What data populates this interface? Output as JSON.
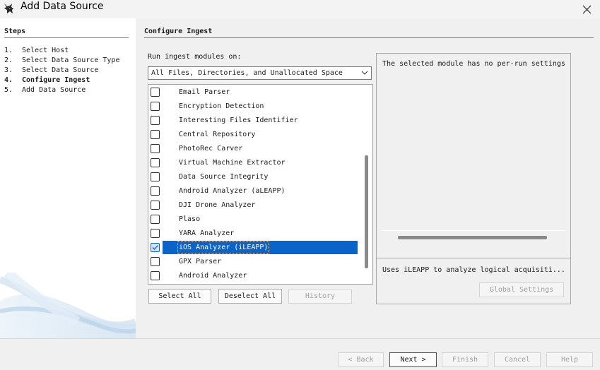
{
  "window": {
    "title": "Add Data Source"
  },
  "steps": {
    "title": "Steps",
    "items": [
      {
        "num": "1.",
        "label": "Select Host",
        "active": false
      },
      {
        "num": "2.",
        "label": "Select Data Source Type",
        "active": false
      },
      {
        "num": "3.",
        "label": "Select Data Source",
        "active": false
      },
      {
        "num": "4.",
        "label": "Configure Ingest",
        "active": true
      },
      {
        "num": "5.",
        "label": "Add Data Source",
        "active": false
      }
    ]
  },
  "configure": {
    "title": "Configure Ingest",
    "run_label": "Run ingest modules on:",
    "run_value": "All Files, Directories, and Unallocated Space",
    "modules": [
      {
        "label": "Email Parser",
        "checked": false,
        "selected": false
      },
      {
        "label": "Encryption Detection",
        "checked": false,
        "selected": false
      },
      {
        "label": "Interesting Files Identifier",
        "checked": false,
        "selected": false
      },
      {
        "label": "Central Repository",
        "checked": false,
        "selected": false
      },
      {
        "label": "PhotoRec Carver",
        "checked": false,
        "selected": false
      },
      {
        "label": "Virtual Machine Extractor",
        "checked": false,
        "selected": false
      },
      {
        "label": "Data Source Integrity",
        "checked": false,
        "selected": false
      },
      {
        "label": "Android Analyzer (aLEAPP)",
        "checked": false,
        "selected": false
      },
      {
        "label": "DJI Drone Analyzer",
        "checked": false,
        "selected": false
      },
      {
        "label": "Plaso",
        "checked": false,
        "selected": false
      },
      {
        "label": "YARA Analyzer",
        "checked": false,
        "selected": false
      },
      {
        "label": "iOS Analyzer (iLEAPP)",
        "checked": true,
        "selected": true
      },
      {
        "label": "GPX Parser",
        "checked": false,
        "selected": false
      },
      {
        "label": "Android Analyzer",
        "checked": false,
        "selected": false
      }
    ],
    "select_all": "Select All",
    "deselect_all": "Deselect All",
    "history": "History",
    "settings_message": "The selected module has no per-run settings",
    "module_description": "Uses iLEAPP to analyze logical acquisiti...",
    "global_settings": "Global Settings"
  },
  "footer": {
    "back": "< Back",
    "next": "Next >",
    "finish": "Finish",
    "cancel": "Cancel",
    "help": "Help"
  },
  "colors": {
    "selection": "#0a64c8",
    "panel": "#f0f0f0"
  },
  "icons": {
    "app": "dog-logo-icon",
    "close": "close-icon",
    "dropdown": "chevron-down-icon",
    "check": "checkmark-icon"
  }
}
